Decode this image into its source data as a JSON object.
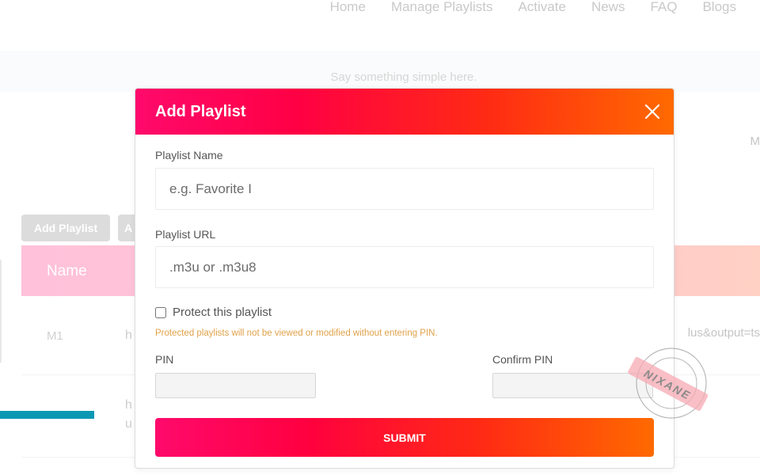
{
  "nav": {
    "items": [
      "Home",
      "Manage Playlists",
      "Activate",
      "News",
      "FAQ",
      "Blogs"
    ]
  },
  "page": {
    "tagline": "Say something simple here.",
    "right_letter": "M",
    "buttons": [
      "Add Playlist",
      "A"
    ],
    "table": {
      "headers": [
        "Name"
      ],
      "rows": [
        {
          "name": "M1",
          "url_start": "h",
          "url_end": "lus&output=ts"
        },
        {
          "name": "",
          "url_start": "h",
          "url_line2": "u"
        }
      ]
    }
  },
  "modal": {
    "title": "Add Playlist",
    "close_icon": "close-icon",
    "playlist_name_label": "Playlist Name",
    "playlist_name_placeholder": "e.g. Favorite I",
    "playlist_name_value": "",
    "playlist_url_label": "Playlist URL",
    "playlist_url_placeholder": ".m3u or .m3u8",
    "playlist_url_value": "",
    "protect_label": "Protect this playlist",
    "protect_checked": false,
    "protect_note": "Protected playlists will not be viewed or modified without entering PIN.",
    "pin_label": "PIN",
    "confirm_pin_label": "Confirm PIN",
    "submit_label": "SUBMIT"
  },
  "watermark": {
    "text": "NIXANE"
  },
  "colors": {
    "gradient_start": "#ff0a6c",
    "gradient_mid": "#ff0044",
    "gradient_end": "#ff6a00",
    "note_color": "#e0a24a",
    "teal_accent": "#0c98b3",
    "table_header": "#ffc1da"
  }
}
